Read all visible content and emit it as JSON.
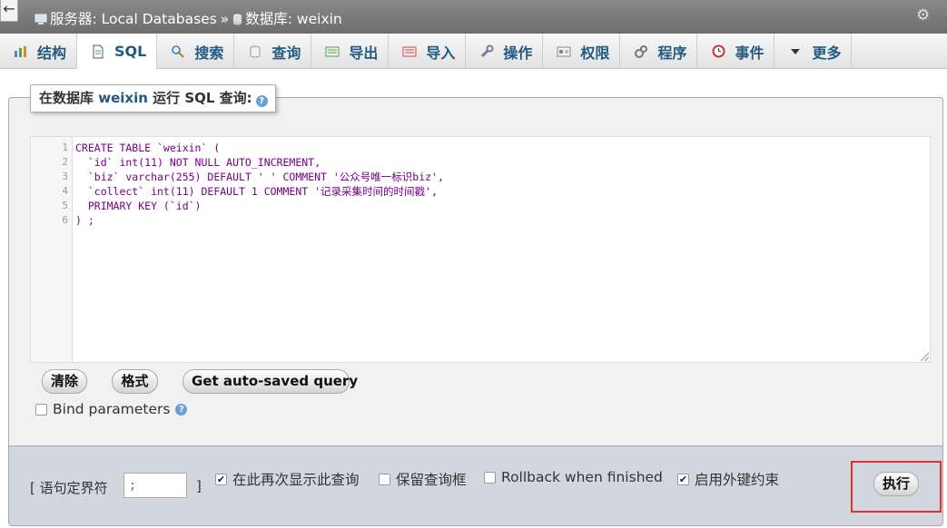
{
  "topbar": {
    "collapse_glyph": "←",
    "server_label": "服务器: Local Databases",
    "separator": "»",
    "database_label": "数据库: weixin",
    "icons": [
      "server-icon",
      "database-icon",
      "gear-icon"
    ]
  },
  "tabs": [
    {
      "label": "结构",
      "icon": "structure-icon"
    },
    {
      "label": "SQL",
      "icon": "sql-icon"
    },
    {
      "label": "搜索",
      "icon": "search-icon"
    },
    {
      "label": "查询",
      "icon": "query-icon"
    },
    {
      "label": "导出",
      "icon": "export-icon"
    },
    {
      "label": "导入",
      "icon": "import-icon"
    },
    {
      "label": "操作",
      "icon": "wrench-icon"
    },
    {
      "label": "权限",
      "icon": "privileges-icon"
    },
    {
      "label": "程序",
      "icon": "routines-icon"
    },
    {
      "label": "事件",
      "icon": "events-icon"
    },
    {
      "label": "更多",
      "icon": "chevron-down-icon"
    }
  ],
  "active_tab": "SQL",
  "query_box": {
    "legend_prefix": "在数据库 ",
    "legend_db": "weixin",
    "legend_suffix": " 运行 SQL 查询:",
    "line_numbers": [
      "1",
      "2",
      "3",
      "4",
      "5",
      "6"
    ],
    "code_lines": [
      "CREATE TABLE `weixin` (",
      "  `id` int(11) NOT NULL AUTO_INCREMENT,",
      "  `biz` varchar(255) DEFAULT ' ' COMMENT '公众号唯一标识biz',",
      "  `collect` int(11) DEFAULT 1 COMMENT '记录采集时间的时间戳',",
      "  PRIMARY KEY (`id`)",
      ") ;"
    ]
  },
  "buttons": {
    "clear": "清除",
    "format": "格式",
    "autosaved": "Get auto-saved query",
    "execute": "执行"
  },
  "bind_parameters": {
    "label": "Bind parameters",
    "checked": false
  },
  "options": {
    "delimiter_label": "[ 语句定界符",
    "delimiter_value": ";",
    "delimiter_close": "]",
    "show_again": {
      "label": "在此再次显示此查询",
      "checked": true
    },
    "retain_box": {
      "label": "保留查询框",
      "checked": false
    },
    "rollback": {
      "label": "Rollback when finished",
      "checked": false
    },
    "foreign_keys": {
      "label": "启用外键约束",
      "checked": true
    }
  },
  "colors": {
    "link_blue": "#235a81",
    "highlight_red": "#e03030",
    "topbar_gray": "#7a7a7a"
  }
}
